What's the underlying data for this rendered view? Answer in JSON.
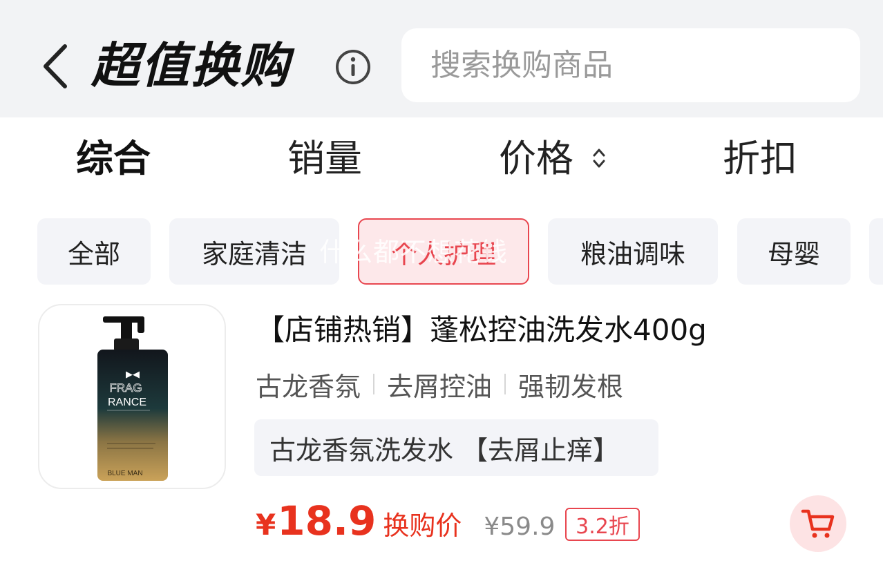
{
  "header": {
    "title": "超值换购",
    "search_placeholder": "搜索换购商品"
  },
  "sort": {
    "items": [
      {
        "label": "综合",
        "active": true
      },
      {
        "label": "销量",
        "active": false
      },
      {
        "label": "价格",
        "active": false
      },
      {
        "label": "折扣",
        "active": false
      }
    ]
  },
  "categories": {
    "items": [
      {
        "label": "全部"
      },
      {
        "label": "家庭清洁"
      },
      {
        "label": "个人护理",
        "active": true
      },
      {
        "label": "粮油调味"
      },
      {
        "label": "母婴"
      }
    ]
  },
  "watermark": "什么都不想花钱",
  "product": {
    "title": "【店铺热销】蓬松控油洗发水400g",
    "tags": [
      "古龙香氛",
      "去屑控油",
      "强韧发根"
    ],
    "description": "古龙香氛洗发水 【去屑止痒】",
    "price_currency": "¥",
    "price": "18.9",
    "price_label": "换购价",
    "original_price": "¥59.9",
    "discount": "3.2折",
    "image_text": {
      "line1": "FRAG",
      "line2": "RANCE",
      "brand": "BLUE MAN"
    }
  },
  "colors": {
    "accent": "#e8321e",
    "chip_active_bg": "#fde8ea",
    "chip_bg": "#f3f4f8",
    "header_bg": "#f2f3f5"
  },
  "icons": {
    "back": "chevron-left-icon",
    "info": "info-icon",
    "sort": "sort-caret-icon",
    "cart": "cart-icon"
  }
}
